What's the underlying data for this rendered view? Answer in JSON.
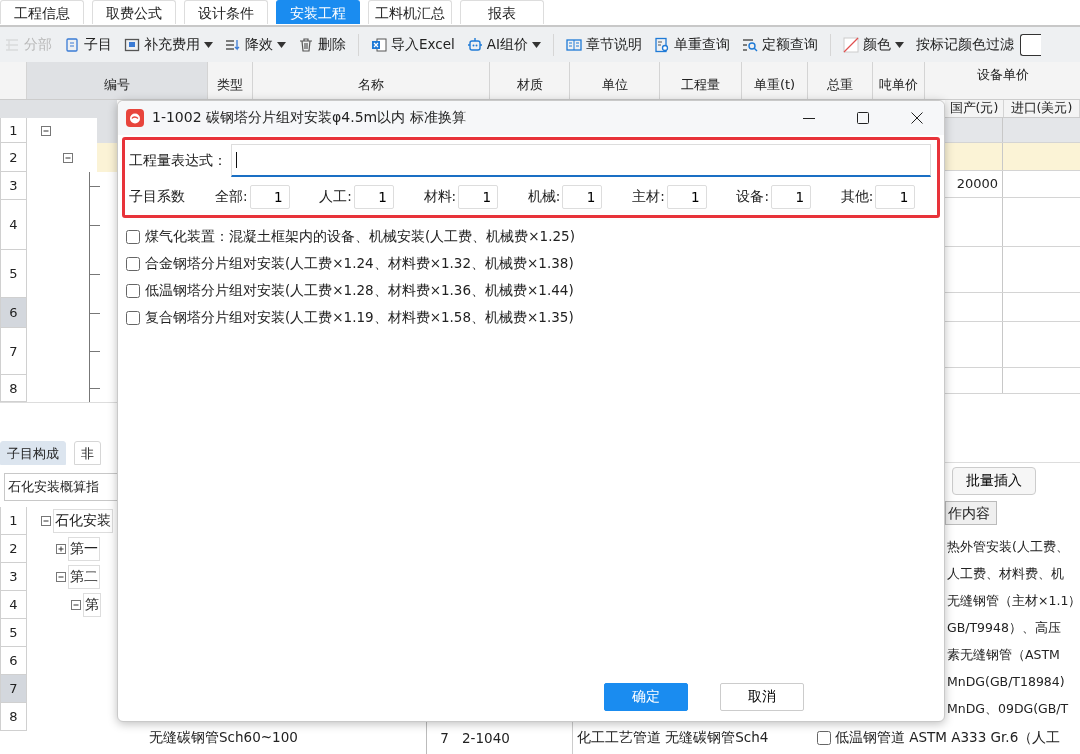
{
  "top_tabs": [
    {
      "label": "工程信息",
      "selected": false
    },
    {
      "label": "取费公式",
      "selected": false
    },
    {
      "label": "设计条件",
      "selected": false
    },
    {
      "label": "安装工程",
      "selected": true
    },
    {
      "label": "工料机汇总",
      "selected": false
    },
    {
      "label": "报表",
      "selected": false
    }
  ],
  "toolbar": [
    {
      "items": [
        {
          "label": "分部",
          "kind": "button",
          "disabled": true,
          "dropdown": false
        },
        {
          "label": "子目",
          "kind": "button",
          "disabled": false,
          "dropdown": false
        },
        {
          "label": "补充费用",
          "kind": "button",
          "disabled": false,
          "dropdown": true
        },
        {
          "label": "降效",
          "kind": "button",
          "disabled": false,
          "dropdown": true
        },
        {
          "label": "删除",
          "kind": "button",
          "disabled": false,
          "dropdown": false
        }
      ]
    },
    {
      "items": [
        {
          "label": "导入Excel",
          "kind": "button",
          "disabled": false,
          "dropdown": false
        },
        {
          "label": "AI组价",
          "kind": "button",
          "disabled": false,
          "dropdown": true
        }
      ]
    },
    {
      "items": [
        {
          "label": "章节说明",
          "kind": "button",
          "disabled": false,
          "dropdown": false
        },
        {
          "label": "单重查询",
          "kind": "button",
          "disabled": false,
          "dropdown": false
        },
        {
          "label": "定额查询",
          "kind": "button",
          "disabled": false,
          "dropdown": false
        }
      ]
    },
    {
      "items": [
        {
          "label": "颜色",
          "kind": "button",
          "disabled": false,
          "dropdown": true
        },
        {
          "label": "按标记颜色过滤",
          "kind": "filter"
        }
      ]
    }
  ],
  "grid": {
    "columns": [
      "编号",
      "类型",
      "名称",
      "材质",
      "单位",
      "工程量",
      "单重(t)",
      "总重",
      "吨单价",
      "设备单价"
    ],
    "sub_columns": [
      "国产(元)",
      "进口(美元)"
    ],
    "rows": [
      {
        "number": "1",
        "kind": "section",
        "selected": false
      },
      {
        "number": "2",
        "kind": "subsection",
        "selected": false
      },
      {
        "number": "3",
        "kind": "item",
        "selected": false,
        "domestic": "20000"
      },
      {
        "number": "4",
        "kind": "item",
        "selected": false
      },
      {
        "number": "5",
        "kind": "item",
        "selected": false
      },
      {
        "number": "6",
        "kind": "item",
        "selected": true
      },
      {
        "number": "7",
        "kind": "item",
        "selected": false
      },
      {
        "number": "8",
        "kind": "item",
        "selected": false
      }
    ]
  },
  "lower_panel": {
    "tabs": [
      {
        "label": "子目构成",
        "selected": true
      },
      {
        "label": "非",
        "selected": false
      }
    ],
    "library": "石化安装概算指",
    "row_numbers": [
      {
        "label": "1",
        "selected": false
      },
      {
        "label": "2",
        "selected": false
      },
      {
        "label": "3",
        "selected": false
      },
      {
        "label": "4",
        "selected": false
      },
      {
        "label": "5",
        "selected": false
      },
      {
        "label": "6",
        "selected": false
      },
      {
        "label": "7",
        "selected": true
      },
      {
        "label": "8",
        "selected": false
      }
    ],
    "tree": [
      {
        "label": "石化安装",
        "expanded": true,
        "children": [
          {
            "label": "第一",
            "expanded": false
          },
          {
            "label": "第二",
            "expanded": true,
            "children": [
              {
                "label": "第",
                "expanded": true
              }
            ]
          }
        ]
      }
    ],
    "batch_insert": "批量插入",
    "content_tab": "作内容",
    "content_lines": [
      "热外管安装(人工费、",
      "人工费、材料费、机",
      "无缝钢管（主材×1.1）",
      "GB/T9948）、高压",
      "素无缝钢管（ASTM",
      "MnDG(GB/T18984)",
      "MnDG、09DG(GB/T"
    ],
    "bottom_row": {
      "name": "无缝碳钢管Sch60~100",
      "number": "7",
      "code": "2-1040",
      "description": "化工工艺管道 无缝碳钢管Sch4",
      "option": {
        "label": "低温钢管道 ASTM A333 Gr.6（人工",
        "checked": false
      }
    }
  },
  "dialog": {
    "title": "1-1002 碳钢塔分片组对安装φ4.5m以内 标准换算",
    "expression": {
      "label": "工程量表达式："
    },
    "coefficients_label": "子目系数",
    "coefficients": [
      {
        "label": "全部:",
        "value": "1"
      },
      {
        "label": "人工:",
        "value": "1"
      },
      {
        "label": "材料:",
        "value": "1"
      },
      {
        "label": "机械:",
        "value": "1"
      },
      {
        "label": "主材:",
        "value": "1"
      },
      {
        "label": "设备:",
        "value": "1"
      },
      {
        "label": "其他:",
        "value": "1"
      }
    ],
    "options": [
      {
        "label": "煤气化装置：混凝土框架内的设备、机械安装(人工费、机械费×1.25)",
        "checked": false
      },
      {
        "label": "合金钢塔分片组对安装(人工费×1.24、材料费×1.32、机械费×1.38)",
        "checked": false
      },
      {
        "label": "低温钢塔分片组对安装(人工费×1.28、材料费×1.36、机械费×1.44)",
        "checked": false
      },
      {
        "label": "复合钢塔分片组对安装(人工费×1.19、材料费×1.58、机械费×1.35)",
        "checked": false
      }
    ],
    "buttons": [
      {
        "label": "确定",
        "kind": "primary"
      },
      {
        "label": "取消",
        "kind": "secondary"
      }
    ]
  }
}
